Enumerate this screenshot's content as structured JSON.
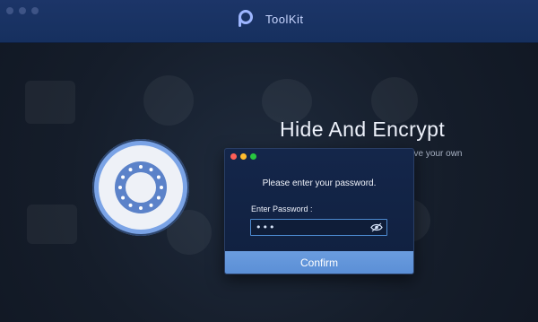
{
  "window": {
    "app_name": "ToolKit",
    "logo_icon": "toolkit-logo-icon",
    "accent": "#7aa3e6"
  },
  "main": {
    "title": "Hide And Encrypt",
    "subtitle_partial": "ave your own"
  },
  "dialog": {
    "prompt": "Please enter your password.",
    "field_label": "Enter Password :",
    "password_value": "•••",
    "reveal_icon": "eye-icon",
    "confirm_label": "Confirm",
    "controls": {
      "close": "#ff5f57",
      "minimize": "#febc2e",
      "zoom": "#28c840"
    }
  }
}
